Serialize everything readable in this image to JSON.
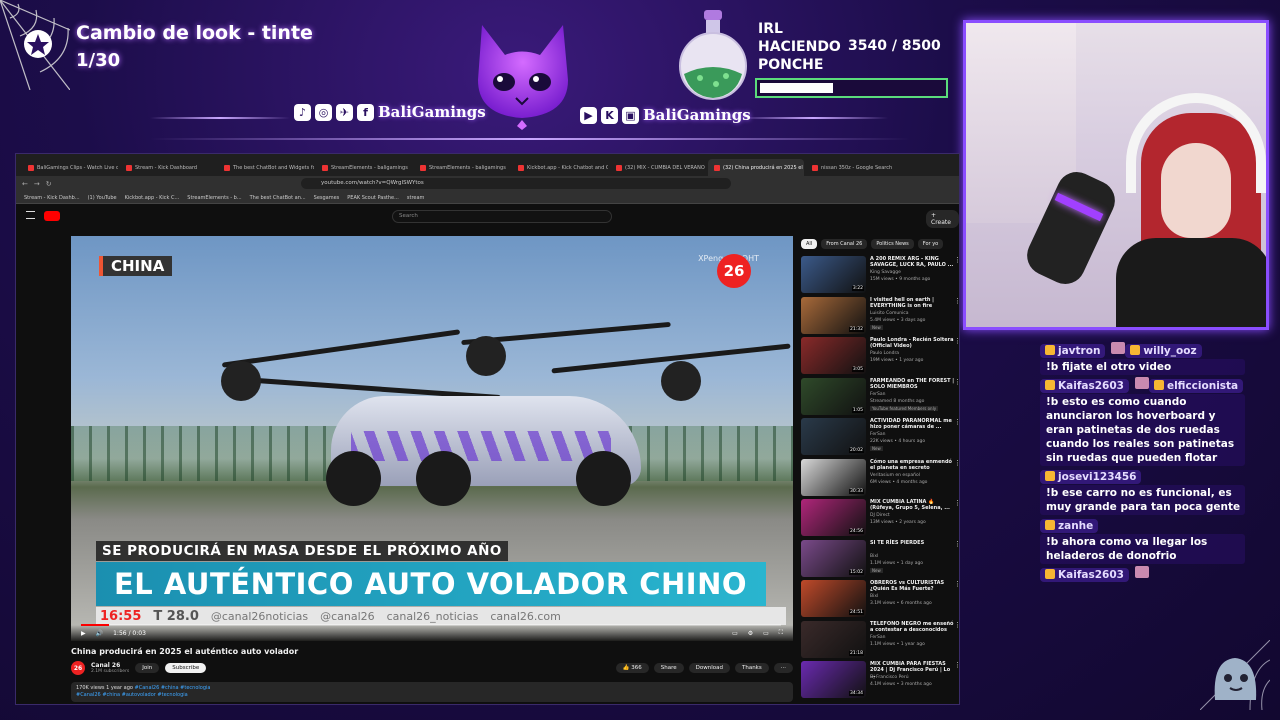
{
  "overlay": {
    "goal_title": "Cambio de look - tinte",
    "goal_count": "1/30",
    "social_name_left": "BaliGamings",
    "social_name_right": "BaliGamings",
    "social_icons_left": [
      "tiktok-icon",
      "instagram-icon",
      "twitter-icon",
      "facebook-icon"
    ],
    "social_icons_right": [
      "youtube-icon",
      "kick-icon",
      "twitch-icon"
    ],
    "irl_line1": "IRL",
    "irl_line2": "HACIENDO",
    "irl_line3": "PONCHE",
    "irl_progress_text": "3540  / 8500",
    "irl_progress_value": 3540,
    "irl_progress_max": 8500,
    "colors": {
      "accent": "#8a4dff",
      "progress_border": "#5bdc7b"
    }
  },
  "browser": {
    "tabs": [
      "BaliGamings Clips - Watch Live on K",
      "Stream - Kick Dashboard",
      "The best ChatBot and Widgets for K",
      "StreamElements - baligamings",
      "StreamElements - baligamings",
      "Kickbot.app - Kick Chatbot and Over",
      "(32) MIX - CUMBIA DEL VERANO",
      "(32) China producirá en 2025 el",
      "nissan 350z - Google Search"
    ],
    "active_tab_index": 7,
    "url": "youtube.com/watch?v=QWrgISWYtos",
    "bookmarks": [
      "Stream - Kick Dashb...",
      "(1) YouTube",
      "Kickbot.app - Kick C...",
      "StreamElements - b...",
      "The best ChatBot an...",
      "Sesgames",
      "PEAK Scout Pasthe...",
      "stream"
    ]
  },
  "youtube": {
    "search_placeholder": "Search",
    "create_label": "+ Create",
    "video": {
      "tag": "CHINA",
      "logo_text": "26",
      "watermark": "XPeng AEROHT",
      "subtitle": "SE PRODUCIRÁ EN MASA DESDE EL PRÓXIMO AÑO",
      "headline": "EL AUTÉNTICO AUTO VOLADOR CHINO",
      "ticker_time": "16:55",
      "ticker_temp": "T 28.0",
      "ticker_items": [
        "@canal26noticias",
        "@canal26",
        "canal26_noticias",
        "canal26.com"
      ],
      "time_display": "1:56 / 0:03",
      "progress_fraction": 0.04
    },
    "title": "China producirá en 2025 el auténtico auto volador",
    "channel": {
      "avatar_text": "26",
      "name": "Canal 26",
      "subscribers": "2.1M subscribers",
      "join_label": "Join",
      "subscribe_label": "Subscribe"
    },
    "actions": {
      "likes": "366",
      "share": "Share",
      "download": "Download",
      "thanks": "Thanks",
      "more": "···"
    },
    "description": {
      "meta": "170K views  1 year ago",
      "hashtags_line1": "#Canal26 #china #tecnologia",
      "hashtags_line2": "#Canal26 #china #autovolador #tecnologia"
    },
    "chips": [
      "All",
      "From Canal 26",
      "Politics News",
      "For yo"
    ],
    "recommendations": [
      {
        "title": "A 200 REMIX ARG - KING SAVAGGE, LUCK RA, PAULO ...",
        "channel": "King Savagge",
        "meta": "15M views • 9 months ago",
        "duration": "3:22",
        "color": "#3b5a8a",
        "badge": ""
      },
      {
        "title": "I visited hell on earth | EVERYTHING is on fire",
        "channel": "Luisito Comunica",
        "meta": "5.4M views • 3 days ago",
        "duration": "21:32",
        "color": "#a86a3a",
        "badge": "New"
      },
      {
        "title": "Paulo Londra - Recién Soltera (Official Video)",
        "channel": "Paulo Londra",
        "meta": "19M views • 1 year ago",
        "duration": "3:05",
        "color": "#8a2a2a",
        "badge": ""
      },
      {
        "title": "FARMEANDO en THE FOREST | SOLO MIEMBROS",
        "channel": "FerSan",
        "meta": "Streamed 8 months ago",
        "duration": "1:05",
        "color": "#2f4a2a",
        "badge": "YouTube featured  Members only"
      },
      {
        "title": "ACTIVIDAD PARANORMAL me hizo poner cámaras de ...",
        "channel": "FerSan",
        "meta": "22K views • 4 hours ago",
        "duration": "20:02",
        "color": "#2a3a4a",
        "badge": "New"
      },
      {
        "title": "Cómo una empresa enmendó el planeta en secreto",
        "channel": "Veritasium en español",
        "meta": "6M views • 4 months ago",
        "duration": "30:33",
        "color": "#d8d8d8",
        "badge": ""
      },
      {
        "title": "MIX CUMBIA LATINA 🔥 (Rüfeya, Grupo 5, Selena, ...",
        "channel": "DJ Direct",
        "meta": "13M views • 2 years ago",
        "duration": "24:56",
        "color": "#b0267a",
        "badge": ""
      },
      {
        "title": "SI TE RÍES PIERDES",
        "channel": "Bixl",
        "meta": "1.1M views • 1 day ago",
        "duration": "15:02",
        "color": "#7a4a8a",
        "badge": "New"
      },
      {
        "title": "OBREROS vs CULTURISTAS ¿Quién Es Más Fuerte?",
        "channel": "Bixl",
        "meta": "3.1M views • 6 months ago",
        "duration": "24:51",
        "color": "#c04a2a",
        "badge": ""
      },
      {
        "title": "TELEFONO NEGRO me enseñó a contestar a desconocidos",
        "channel": "FerSan",
        "meta": "1.1M views • 1 year ago",
        "duration": "21:18",
        "color": "#3a2a2a",
        "badge": ""
      },
      {
        "title": "MIX CUMBIA PARA FIESTAS 2024 | Dj Francisco Perú | Lo ...",
        "channel": "Dj Francisco Perú",
        "meta": "4.1M views • 3 months ago",
        "duration": "34:34",
        "color": "#6a2ab0",
        "badge": ""
      }
    ]
  },
  "chat": [
    {
      "user": "javtron",
      "message": "",
      "emote": true
    },
    {
      "user": "willy_ooz",
      "message": "!b fijate el otro video",
      "emote": false
    },
    {
      "user": "Kaifas2603",
      "message": "",
      "emote": true
    },
    {
      "user": "elficcionista",
      "message": "!b esto es como cuando anunciaron los hoverboard y eran patinetas de dos ruedas cuando los reales son patinetas sin ruedas que pueden flotar",
      "emote": false
    },
    {
      "user": "josevi123456",
      "message": "!b ese carro no es funcional, es muy grande para tan poca gente",
      "emote": false
    },
    {
      "user": "zanhe",
      "message": "!b ahora como va llegar los heladeros de donofrio",
      "emote": false
    },
    {
      "user": "Kaifas2603",
      "message": "",
      "emote": true
    }
  ]
}
